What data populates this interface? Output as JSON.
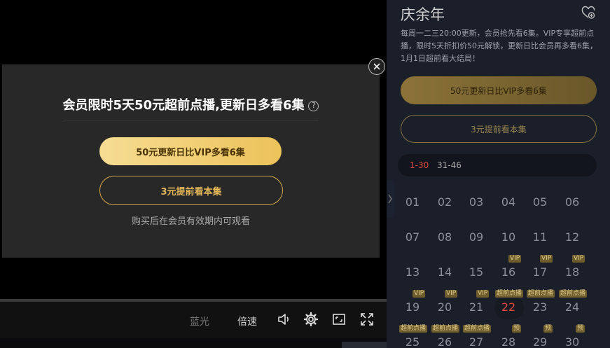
{
  "player": {
    "controls": {
      "quality_label": "蓝光",
      "speed_label": "倍速",
      "volume_icon": "volume-icon",
      "settings_icon": "gear-icon",
      "fullscreen_window_icon": "window-fullscreen-icon",
      "fullscreen_icon": "fullscreen-icon"
    }
  },
  "modal": {
    "title": "会员限时5天50元超前点播,更新日多看6集",
    "help_symbol": "?",
    "vip_button_label": "50元更新日比VIP多看6集",
    "single_button_label": "3元提前看本集",
    "note": "购买后在会员有效期内可观看",
    "close_icon": "close-icon"
  },
  "panel": {
    "title": "庆余年",
    "favorite_icon": "heart-plus-icon",
    "description": "每周一二三20:00更新，会员抢先看6集。VIP专享超前点播，限时5天折扣价50元解锁，更新日比会员再多看6集，1月1日超前看大结局！",
    "vip_button_label": "50元更新日比VIP多看6集",
    "single_button_label": "3元提前看本集",
    "range_tabs": [
      {
        "label": "1-30",
        "active": true
      },
      {
        "label": "31-46",
        "active": false
      }
    ],
    "episodes": [
      {
        "num": "01",
        "badge": ""
      },
      {
        "num": "02",
        "badge": ""
      },
      {
        "num": "03",
        "badge": ""
      },
      {
        "num": "04",
        "badge": ""
      },
      {
        "num": "05",
        "badge": ""
      },
      {
        "num": "06",
        "badge": ""
      },
      {
        "num": "07",
        "badge": ""
      },
      {
        "num": "08",
        "badge": ""
      },
      {
        "num": "09",
        "badge": ""
      },
      {
        "num": "10",
        "badge": ""
      },
      {
        "num": "11",
        "badge": ""
      },
      {
        "num": "12",
        "badge": ""
      },
      {
        "num": "13",
        "badge": ""
      },
      {
        "num": "14",
        "badge": ""
      },
      {
        "num": "15",
        "badge": ""
      },
      {
        "num": "16",
        "badge": "VIP"
      },
      {
        "num": "17",
        "badge": "VIP"
      },
      {
        "num": "18",
        "badge": "VIP"
      },
      {
        "num": "19",
        "badge": "VIP"
      },
      {
        "num": "20",
        "badge": "VIP"
      },
      {
        "num": "21",
        "badge": "VIP"
      },
      {
        "num": "22",
        "badge": "超前点播",
        "active": true
      },
      {
        "num": "23",
        "badge": "超前点播"
      },
      {
        "num": "24",
        "badge": "超前点播"
      },
      {
        "num": "25",
        "badge": "超前点播"
      },
      {
        "num": "26",
        "badge": "超前点播"
      },
      {
        "num": "27",
        "badge": "超前点播"
      },
      {
        "num": "28",
        "badge": "预"
      },
      {
        "num": "29",
        "badge": "预"
      },
      {
        "num": "30",
        "badge": "预"
      }
    ]
  },
  "colors": {
    "gold_light": "#f6dd93",
    "gold_dark": "#ecc259",
    "active_red": "#d84b3b",
    "panel_bg": "#1b1f2a"
  }
}
